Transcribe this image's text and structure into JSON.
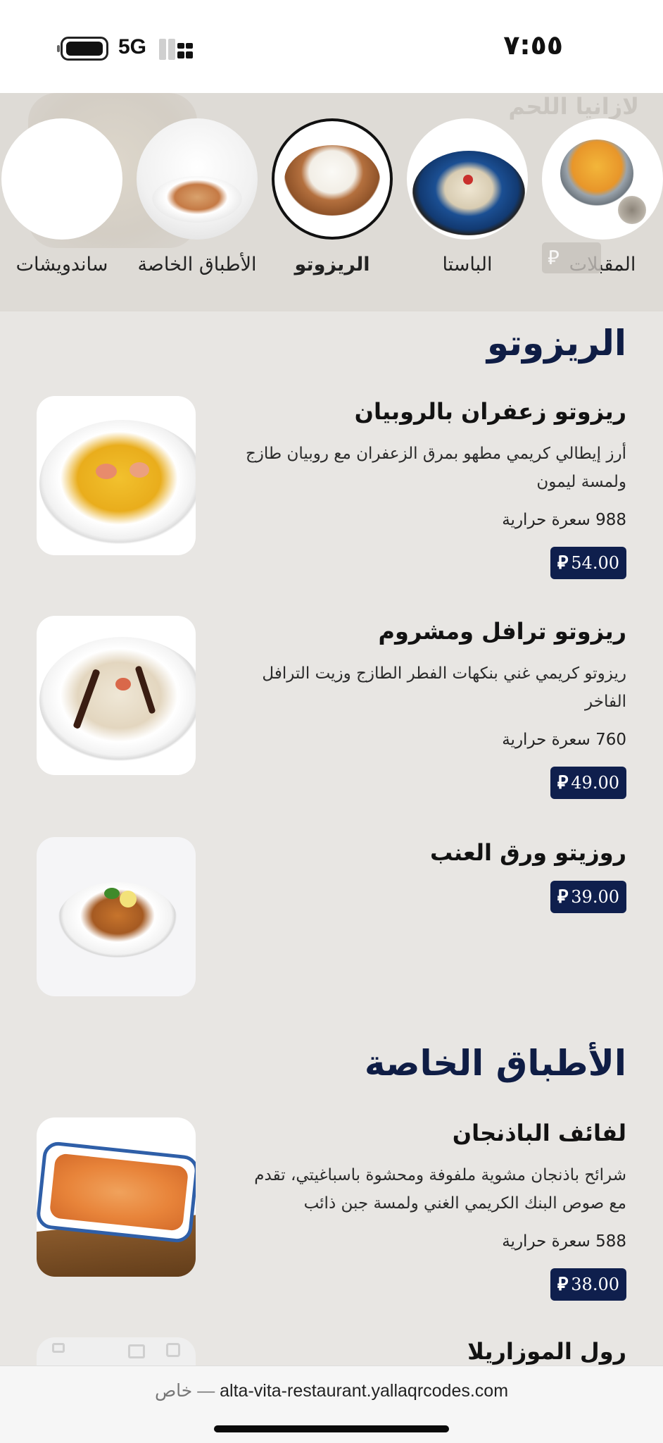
{
  "status_bar": {
    "time": "٧:٥٥",
    "network": "5G"
  },
  "categories": [
    {
      "label": "المقبلات",
      "active": false
    },
    {
      "label": "الباستا",
      "active": false
    },
    {
      "label": "الريزوتو",
      "active": true
    },
    {
      "label": "الأطباق الخاصة",
      "active": false
    },
    {
      "label": "ساندويشات",
      "active": false
    }
  ],
  "ghost_card": {
    "title": "لازانيا اللحم"
  },
  "currency_symbol": "⃁",
  "sections": [
    {
      "title": "الريزوتو",
      "items": [
        {
          "name": "ريزوتو زعفران بالروبيان",
          "description": "أرز إيطالي كريمي مطهو بمرق الزعفران مع روبيان طازج ولمسة ليمون",
          "calories_value": "988",
          "calories_label": "سعرة حرارية",
          "price": "54.00"
        },
        {
          "name": "ريزوتو ترافل ومشروم",
          "description": "ريزوتو كريمي غني بنكهات الفطر الطازج وزيت الترافل الفاخر",
          "calories_value": "760",
          "calories_label": "سعرة حرارية",
          "price": "49.00"
        },
        {
          "name": "روزيتو ورق العنب",
          "price": "39.00"
        }
      ]
    },
    {
      "title": "الأطباق الخاصة",
      "items": [
        {
          "name": "لفائف الباذنجان",
          "description": "شرائح باذنجان مشوية ملفوفة ومحشوة باسباغيتي، تقدم مع صوص البنك الكريمي الغني ولمسة جبن ذائب",
          "calories_value": "588",
          "calories_label": "سعرة حرارية",
          "price": "38.00"
        },
        {
          "name": "رول الموزاريلا"
        }
      ]
    }
  ],
  "url_bar": {
    "url": "alta-vita-restaurant.yallaqrcodes.com",
    "separator": "—",
    "private_label": "خاص"
  },
  "colors": {
    "page_bg": "#e8e6e3",
    "strip_bg": "#dedbd6",
    "accent_navy": "#0f1f4d",
    "title_navy": "#0f1d45"
  }
}
